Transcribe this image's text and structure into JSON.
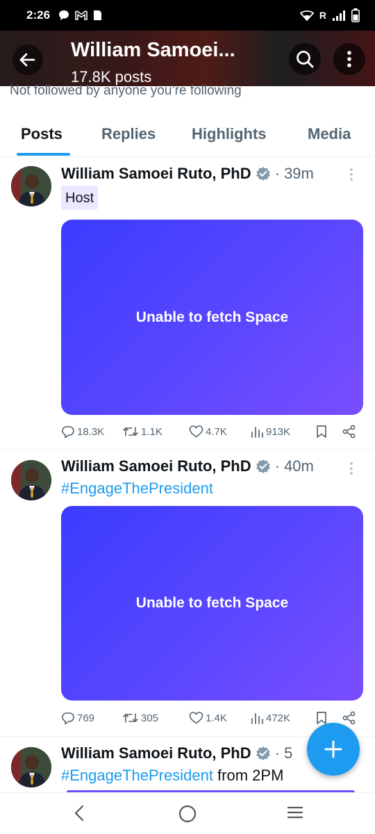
{
  "status_bar": {
    "time": "2:26",
    "carrier_indicator": "R"
  },
  "header": {
    "title": "William Samoei...",
    "subtitle": "17.8K posts",
    "followed_by": "Not followed by anyone you’re following"
  },
  "tabs": [
    {
      "label": "Posts",
      "active": true
    },
    {
      "label": "Replies",
      "active": false
    },
    {
      "label": "Highlights",
      "active": false
    },
    {
      "label": "Media",
      "active": false
    }
  ],
  "posts": [
    {
      "author": "William Samoei Ruto, PhD",
      "time": "· 39m",
      "badge": "Host",
      "card_text": "Unable to fetch Space",
      "stats": {
        "replies": "18.3K",
        "reposts": "1.1K",
        "likes": "4.7K",
        "views": "913K"
      }
    },
    {
      "author": "William Samoei Ruto, PhD",
      "time": "· 40m",
      "hashtag": "#EngageThePresident",
      "card_text": "Unable to fetch Space",
      "stats": {
        "replies": "769",
        "reposts": "305",
        "likes": "1.4K",
        "views": "472K"
      }
    },
    {
      "author": "William Samoei Ruto, PhD",
      "time": "· 5",
      "hashtag": "#EngageThePresident",
      "text_after": " from 2PM"
    }
  ],
  "icons": {
    "back": "arrow-left-icon",
    "search": "search-icon",
    "more": "more-vertical-icon",
    "verified": "verified-badge-icon",
    "reply": "comment-icon",
    "repost": "repost-icon",
    "like": "heart-icon",
    "views": "bar-chart-icon",
    "bookmark": "bookmark-icon",
    "share": "share-icon",
    "compose": "plus-icon"
  },
  "colors": {
    "accent": "#1d9bf0",
    "space_card": "#4b42ff",
    "host_badge_bg": "#ece6ff"
  }
}
